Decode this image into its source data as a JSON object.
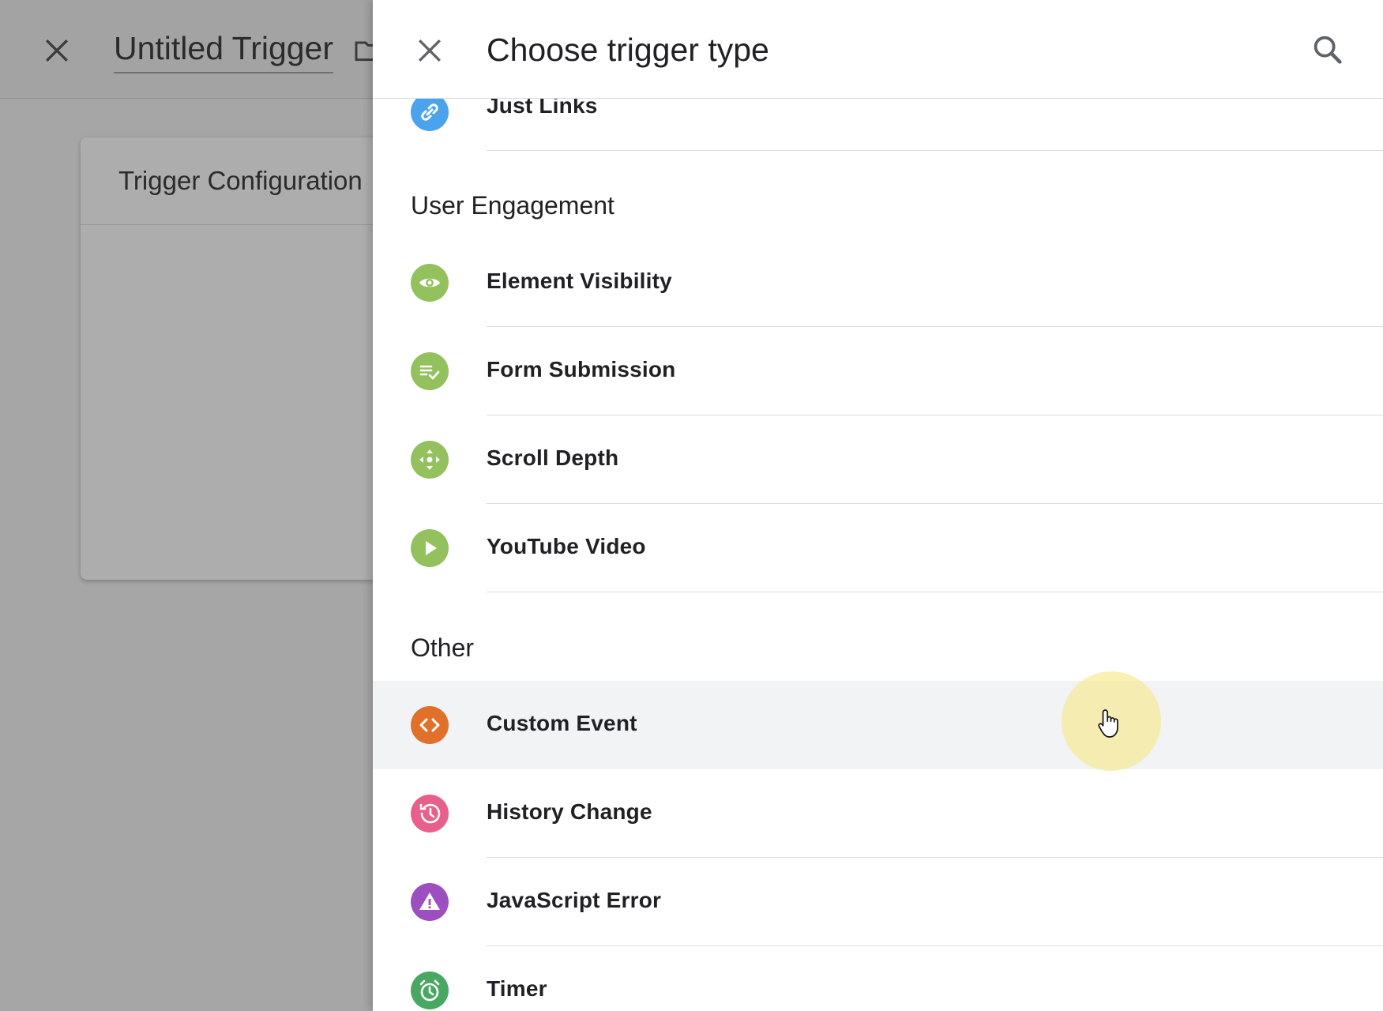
{
  "editor": {
    "title": "Untitled Trigger",
    "card_title": "Trigger Configuration"
  },
  "panel": {
    "title": "Choose trigger type"
  },
  "partial_item": {
    "label": "Just Links",
    "icon": "link-icon",
    "color": "#4aa3ec"
  },
  "sections": [
    {
      "title": "User Engagement",
      "items": [
        {
          "label": "Element Visibility",
          "icon": "eye-icon",
          "color": "#93c15d"
        },
        {
          "label": "Form Submission",
          "icon": "form-check-icon",
          "color": "#93c15d"
        },
        {
          "label": "Scroll Depth",
          "icon": "scroll-arrows-icon",
          "color": "#93c15d"
        },
        {
          "label": "YouTube Video",
          "icon": "play-icon",
          "color": "#93c15d"
        }
      ]
    },
    {
      "title": "Other",
      "items": [
        {
          "label": "Custom Event",
          "icon": "code-icon",
          "color": "#e0702a",
          "hovered": true
        },
        {
          "label": "History Change",
          "icon": "history-icon",
          "color": "#e8608a"
        },
        {
          "label": "JavaScript Error",
          "icon": "warning-icon",
          "color": "#9d4fc0"
        },
        {
          "label": "Timer",
          "icon": "alarm-icon",
          "color": "#48a861"
        }
      ]
    }
  ]
}
